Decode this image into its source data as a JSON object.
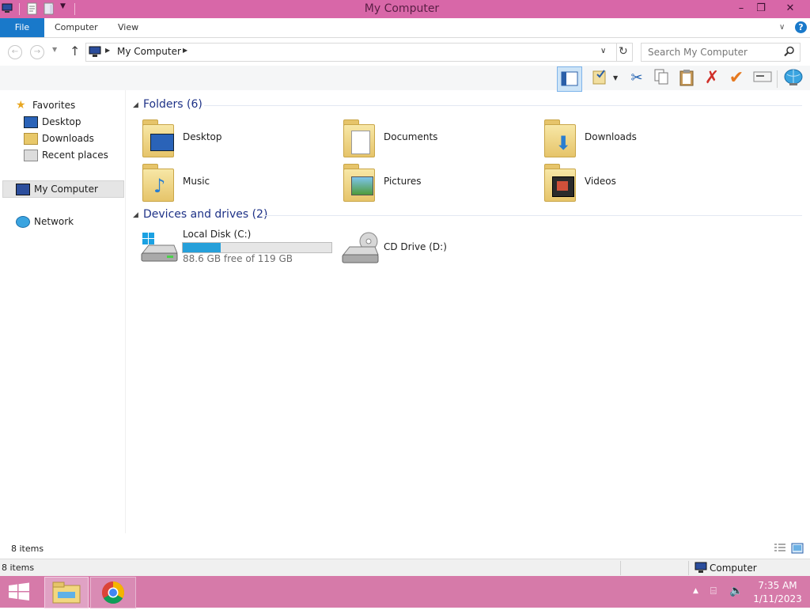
{
  "window": {
    "title": "My Computer",
    "controls": {
      "minimize": "–",
      "maximize": "❐",
      "close": "✕"
    }
  },
  "ribbon": {
    "file_tab": "File",
    "tabs": [
      "Computer",
      "View"
    ]
  },
  "address": {
    "path": "My Computer",
    "search_placeholder": "Search My Computer"
  },
  "nav": {
    "favorites_label": "Favorites",
    "favorites": [
      "Desktop",
      "Downloads",
      "Recent places"
    ],
    "my_computer": "My Computer",
    "network": "Network"
  },
  "content": {
    "folders_header": "Folders (6)",
    "folders": [
      "Desktop",
      "Documents",
      "Downloads",
      "Music",
      "Pictures",
      "Videos"
    ],
    "devices_header": "Devices and drives (2)",
    "drives": [
      {
        "name": "Local Disk (C:)",
        "free_text": "88.6 GB free of 119 GB",
        "used_fraction": 0.255
      },
      {
        "name": "CD Drive (D:)"
      }
    ]
  },
  "status": {
    "items": "8 items",
    "details_items": "8 items",
    "details_location": "Computer"
  },
  "taskbar": {
    "time": "7:35 AM",
    "date": "1/11/2023"
  },
  "colors": {
    "titlebar": "#d867a8",
    "taskbar": "#d67aa9",
    "file_tab": "#1979ca",
    "group_header": "#1e3287",
    "drive_bar": "#26a0da"
  }
}
